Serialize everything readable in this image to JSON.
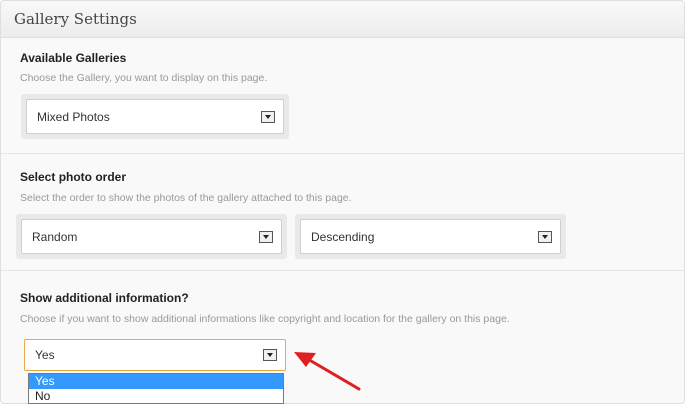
{
  "panel": {
    "title": "Gallery Settings"
  },
  "available_galleries": {
    "label": "Available Galleries",
    "description": "Choose the Gallery, you want to display on this page.",
    "selected": "Mixed Photos"
  },
  "photo_order": {
    "label": "Select photo order",
    "description": "Select the order to show the photos of the gallery attached to this page.",
    "order_selected": "Random",
    "direction_selected": "Descending"
  },
  "additional_info": {
    "label": "Show additional information?",
    "description": "Choose if you want to show additional informations like copyright and location for the gallery on this page.",
    "selected": "Yes",
    "options": [
      "Yes",
      "No"
    ]
  },
  "colors": {
    "focus_border": "#e8a94b",
    "option_highlight": "#3399ff",
    "arrow_annotation": "#e02020"
  }
}
